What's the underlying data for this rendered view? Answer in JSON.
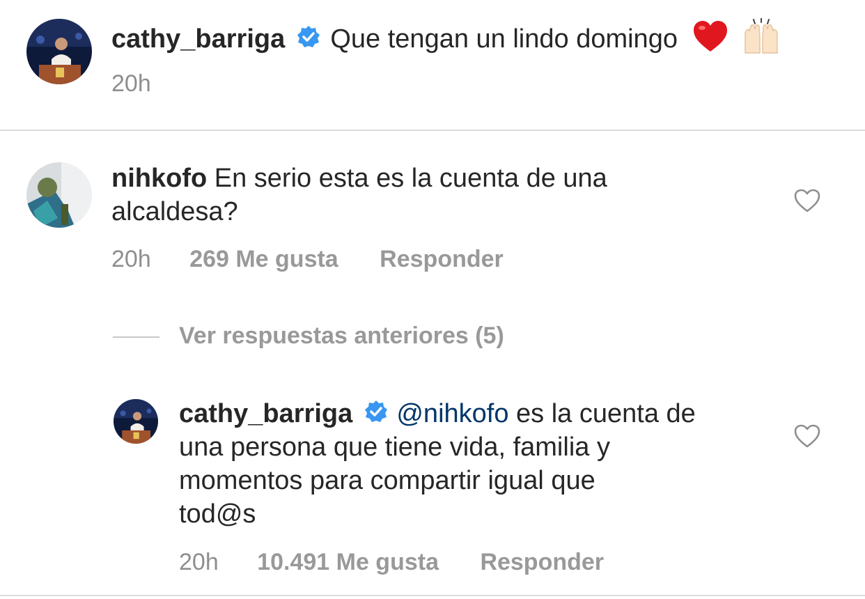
{
  "caption": {
    "username": "cathy_barriga",
    "verified": true,
    "text": "Que tengan un lindo domingo",
    "emojis": [
      "red-heart-emoji",
      "raising-hands-emoji"
    ],
    "time": "20h"
  },
  "comment": {
    "username": "nihkofo",
    "text_line1": "En serio esta es la cuenta de una",
    "text_line2": "alcaldesa?",
    "time": "20h",
    "likes": "269 Me gusta",
    "reply_label": "Responder"
  },
  "view_replies": {
    "label": "Ver respuestas anteriores (5)"
  },
  "reply": {
    "username": "cathy_barriga",
    "verified": true,
    "mention": "@nihkofo",
    "text_line1_rest": " es la cuenta de",
    "text_line2": "una persona que tiene vida, familia y",
    "text_line3": "momentos para compartir igual que",
    "text_line4": "tod@s",
    "time": "20h",
    "likes": "10.491 Me gusta",
    "reply_label": "Responder"
  },
  "colors": {
    "text": "#262626",
    "meta": "#8e8e8e",
    "mention": "#003569",
    "verified": "#3897f0",
    "divider": "#dbdbdb"
  }
}
